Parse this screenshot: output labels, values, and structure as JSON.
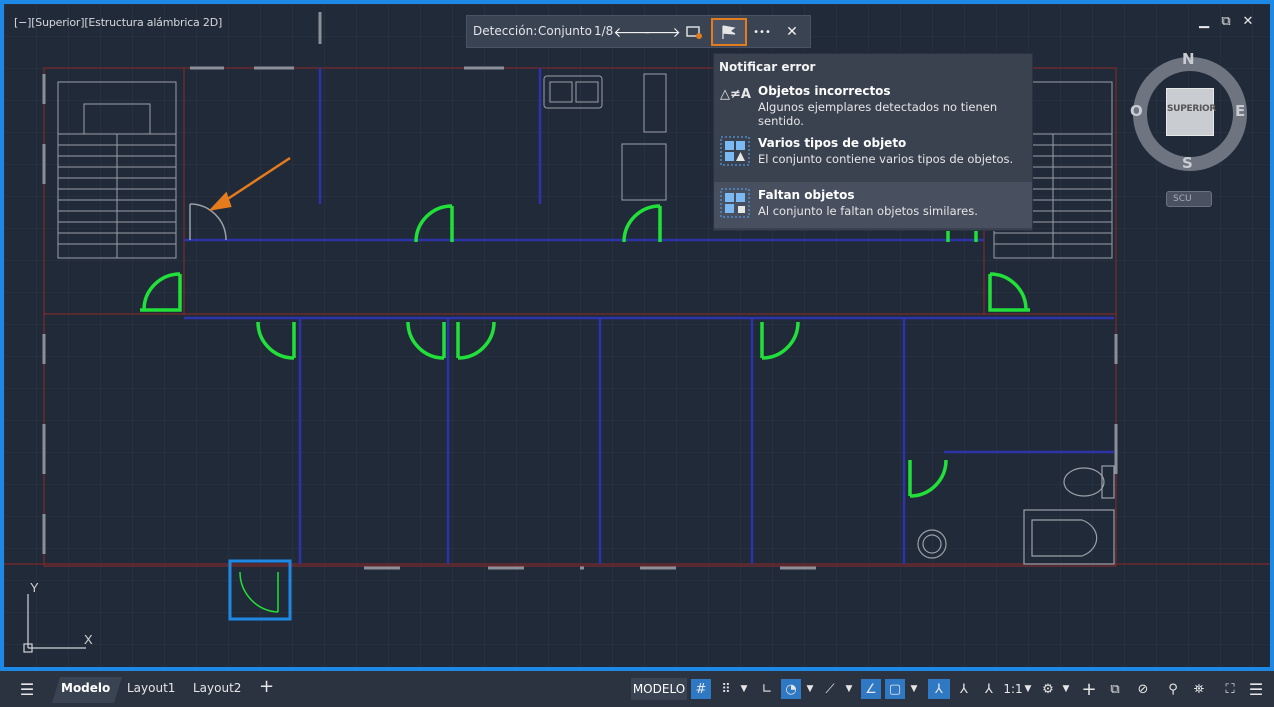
{
  "viewport": {
    "label": "[−][Superior][Estructura alámbrica 2D]",
    "controls": [
      "▁",
      "⧉",
      "✕"
    ]
  },
  "detection_toolbar": {
    "label": "Detección:",
    "set_label": "Conjunto",
    "counter": "1/8",
    "prev_icon": "🡐",
    "next_icon": "🡒",
    "more_icon": "•••",
    "close_icon": "✕"
  },
  "report_menu": {
    "title": "Notificar error",
    "items": [
      {
        "heading": "Objetos incorrectos",
        "desc": "Algunos ejemplares detectados no tienen sentido.",
        "icon_text": "△≠A"
      },
      {
        "heading": "Varios tipos de objeto",
        "desc": "El conjunto contiene varios tipos de objetos."
      },
      {
        "heading": "Faltan objetos",
        "desc": "Al conjunto le faltan objetos similares."
      }
    ]
  },
  "navcube": {
    "north": "N",
    "south": "S",
    "east": "E",
    "west": "O",
    "face": "SUPERIOR",
    "ucs": "SCU"
  },
  "ucs_icon": {
    "x": "X",
    "y": "Y"
  },
  "status_bar": {
    "tabs": [
      "Modelo",
      "Layout1",
      "Layout2"
    ],
    "add_tab": "+",
    "model_button": "MODELO",
    "scale": "1:1"
  },
  "colors": {
    "accent": "#1e88e5",
    "highlight": "#e47c1d",
    "door": "#22e03a",
    "wall": "#2d33a8"
  }
}
